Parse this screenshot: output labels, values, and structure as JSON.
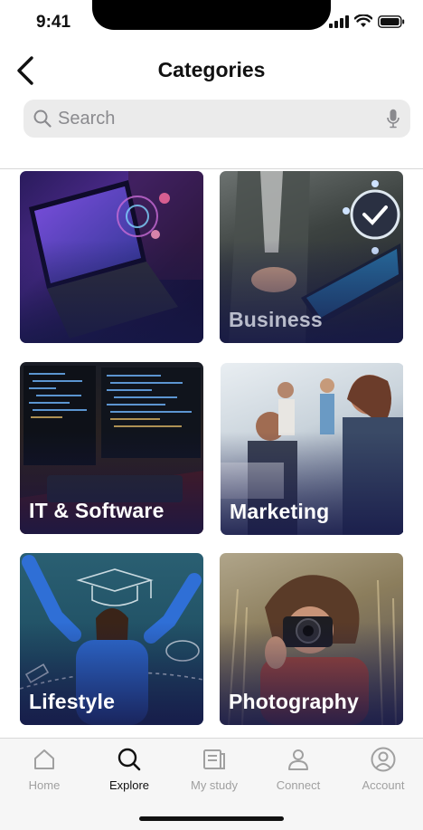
{
  "status_bar": {
    "time": "9:41"
  },
  "header": {
    "title": "Categories"
  },
  "search": {
    "placeholder": "Search",
    "value": ""
  },
  "categories": [
    {
      "label": ""
    },
    {
      "label": "Business"
    },
    {
      "label": "IT & Software"
    },
    {
      "label": "Marketing"
    },
    {
      "label": "Lifestyle"
    },
    {
      "label": "Photography"
    }
  ],
  "tab_bar": {
    "tabs": [
      {
        "label": "Home",
        "icon": "home-icon"
      },
      {
        "label": "Explore",
        "icon": "search-icon",
        "active": true
      },
      {
        "label": "My study",
        "icon": "book-icon"
      },
      {
        "label": "Connect",
        "icon": "person-icon"
      },
      {
        "label": "Account",
        "icon": "account-icon"
      }
    ]
  },
  "colors": {
    "card_overlay": "#16184a",
    "tab_inactive": "#a0a0a0",
    "tab_active": "#111111",
    "search_bg": "#ebebeb"
  }
}
